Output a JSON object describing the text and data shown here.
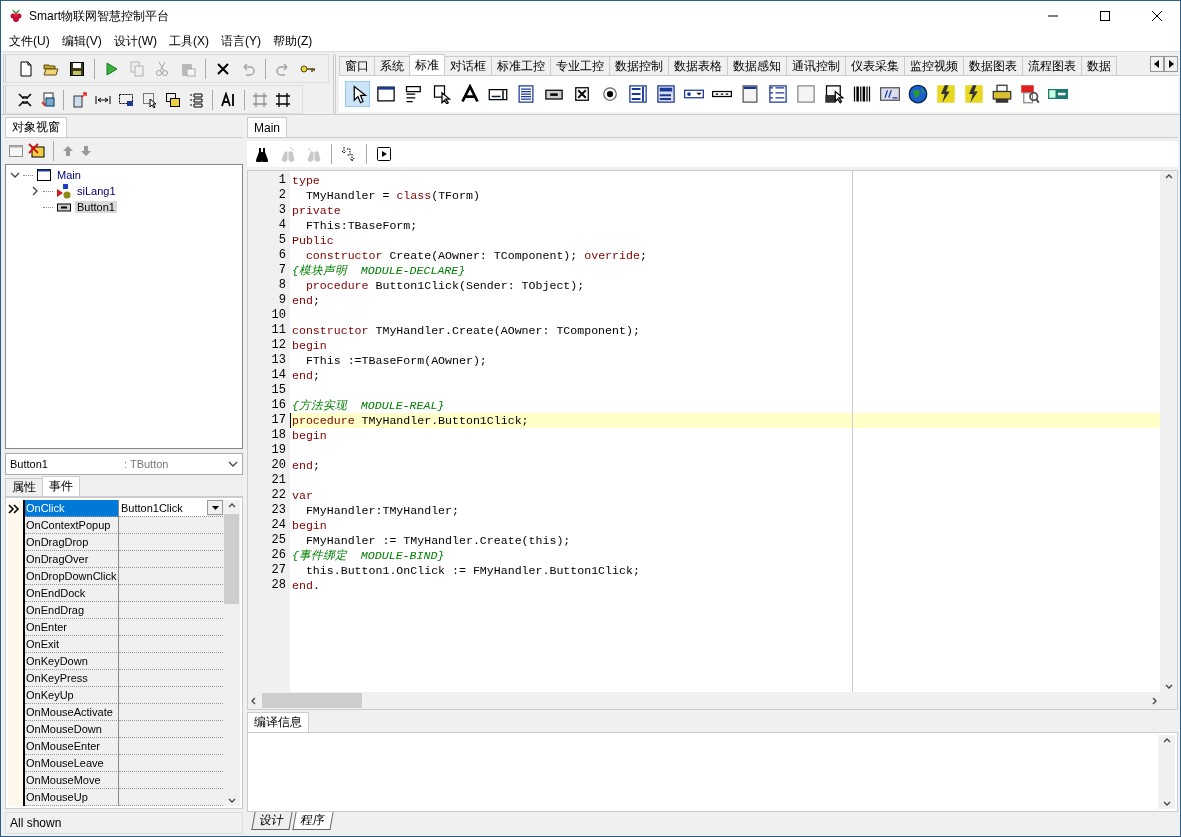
{
  "window": {
    "title": "Smart物联网智慧控制平台"
  },
  "menu": [
    "文件(U)",
    "编辑(V)",
    "设计(W)",
    "工具(X)",
    "语言(Y)",
    "帮助(Z)"
  ],
  "toolbar_main": [
    {
      "disabled": false
    },
    {
      "disabled": false
    },
    {
      "disabled": false
    },
    {
      "disabled": false
    },
    {
      "disabled": true
    },
    {
      "disabled": true
    },
    {
      "disabled": true
    },
    {
      "disabled": false
    },
    {
      "disabled": true
    },
    {
      "disabled": true
    },
    {
      "disabled": false
    }
  ],
  "toolbar_layout": [
    {
      "disabled": false
    },
    {
      "disabled": false
    },
    {
      "disabled": false
    },
    {
      "disabled": false
    },
    {
      "disabled": false
    },
    {
      "disabled": false
    },
    {
      "disabled": false
    },
    {
      "disabled": false
    },
    {
      "disabled": false
    },
    {
      "disabled": true
    },
    {
      "disabled": false
    }
  ],
  "palette": {
    "tabs": [
      {
        "label": "窗口",
        "selected": false
      },
      {
        "label": "系统",
        "selected": false
      },
      {
        "label": "标准",
        "selected": true
      },
      {
        "label": "对话框",
        "selected": false
      },
      {
        "label": "标准工控",
        "selected": false
      },
      {
        "label": "专业工控",
        "selected": false
      },
      {
        "label": "数据控制",
        "selected": false
      },
      {
        "label": "数据表格",
        "selected": false
      },
      {
        "label": "数据感知",
        "selected": false
      },
      {
        "label": "通讯控制",
        "selected": false
      },
      {
        "label": "仪表采集",
        "selected": false
      },
      {
        "label": "监控视频",
        "selected": false
      },
      {
        "label": "数据图表",
        "selected": false
      },
      {
        "label": "流程图表",
        "selected": false
      },
      {
        "label": "数据",
        "selected": false
      }
    ],
    "tools": [
      {
        "selected": true
      },
      {
        "selected": false
      },
      {
        "selected": false
      },
      {
        "selected": false
      },
      {
        "selected": false
      },
      {
        "selected": false
      },
      {
        "selected": false
      },
      {
        "selected": false
      },
      {
        "selected": false
      },
      {
        "selected": false
      },
      {
        "selected": false
      },
      {
        "selected": false
      },
      {
        "selected": false
      },
      {
        "selected": false
      },
      {
        "selected": false
      },
      {
        "selected": false
      },
      {
        "selected": false
      },
      {
        "selected": false
      },
      {
        "selected": false
      },
      {
        "selected": false
      },
      {
        "selected": false
      },
      {
        "selected": false
      },
      {
        "selected": false
      },
      {
        "selected": false
      },
      {
        "selected": false
      },
      {
        "selected": false
      }
    ]
  },
  "object_view": {
    "tab": "对象视窗",
    "tree": [
      {
        "label": "Main",
        "expanded": true,
        "selected": false,
        "children": [
          {
            "label": "siLang1",
            "expanded": false,
            "selected": false
          },
          {
            "label": "Button1",
            "selected": true
          }
        ]
      }
    ]
  },
  "inspector": {
    "object": "Button1",
    "class": ": TButton",
    "tabs": [
      {
        "label": "属性",
        "selected": false
      },
      {
        "label": "事件",
        "selected": true
      }
    ],
    "events": [
      {
        "name": "OnClick",
        "value": "Button1Click",
        "selected": true
      },
      {
        "name": "OnContextPopup",
        "selected": false
      },
      {
        "name": "OnDragDrop",
        "selected": false
      },
      {
        "name": "OnDragOver",
        "selected": false
      },
      {
        "name": "OnDropDownClick",
        "selected": false
      },
      {
        "name": "OnEndDock",
        "selected": false
      },
      {
        "name": "OnEndDrag",
        "selected": false
      },
      {
        "name": "OnEnter",
        "selected": false
      },
      {
        "name": "OnExit",
        "selected": false
      },
      {
        "name": "OnKeyDown",
        "selected": false
      },
      {
        "name": "OnKeyPress",
        "selected": false
      },
      {
        "name": "OnKeyUp",
        "selected": false
      },
      {
        "name": "OnMouseActivate",
        "selected": false
      },
      {
        "name": "OnMouseDown",
        "selected": false
      },
      {
        "name": "OnMouseEnter",
        "selected": false
      },
      {
        "name": "OnMouseLeave",
        "selected": false
      },
      {
        "name": "OnMouseMove",
        "selected": false
      },
      {
        "name": "OnMouseUp",
        "selected": false
      }
    ],
    "status": "All shown"
  },
  "editor": {
    "tab": "Main",
    "toolbar": [
      {
        "disabled": false
      },
      {
        "disabled": true
      },
      {
        "disabled": true
      },
      {
        "disabled": false
      },
      {
        "disabled": false
      }
    ],
    "lines": [
      {
        "num": "1",
        "current": false,
        "tokens": [
          {
            "kind": "keyword",
            "text": "type"
          }
        ]
      },
      {
        "num": "2",
        "current": false,
        "tokens": [
          {
            "kind": "text",
            "text": "  TMyHandler = "
          },
          {
            "kind": "keyword",
            "text": "class"
          },
          {
            "kind": "text",
            "text": "(TForm)"
          }
        ]
      },
      {
        "num": "3",
        "current": false,
        "tokens": [
          {
            "kind": "keyword",
            "text": "private"
          }
        ]
      },
      {
        "num": "4",
        "current": false,
        "tokens": [
          {
            "kind": "text",
            "text": "  FThis:TBaseForm;"
          }
        ]
      },
      {
        "num": "5",
        "current": false,
        "tokens": [
          {
            "kind": "keyword",
            "text": "Public"
          }
        ]
      },
      {
        "num": "6",
        "current": false,
        "tokens": [
          {
            "kind": "keyword",
            "text": "  constructor"
          },
          {
            "kind": "text",
            "text": " Create(AOwner: TComponent); "
          },
          {
            "kind": "keyword",
            "text": "override"
          },
          {
            "kind": "text",
            "text": ";"
          }
        ]
      },
      {
        "num": "7",
        "current": false,
        "tokens": [
          {
            "kind": "comment",
            "text": "{模块声明  MODULE-DECLARE}"
          }
        ]
      },
      {
        "num": "8",
        "current": false,
        "tokens": [
          {
            "kind": "keyword",
            "text": "  procedure"
          },
          {
            "kind": "text",
            "text": " Button1Click(Sender: TObject);"
          }
        ]
      },
      {
        "num": "9",
        "current": false,
        "tokens": [
          {
            "kind": "keyword",
            "text": "end"
          },
          {
            "kind": "text",
            "text": ";"
          }
        ]
      },
      {
        "num": "10",
        "current": false
      },
      {
        "num": "11",
        "current": false,
        "tokens": [
          {
            "kind": "keyword",
            "text": "constructor"
          },
          {
            "kind": "text",
            "text": " TMyHandler.Create(AOwner: TComponent);"
          }
        ]
      },
      {
        "num": "12",
        "current": false,
        "tokens": [
          {
            "kind": "keyword",
            "text": "begin"
          }
        ]
      },
      {
        "num": "13",
        "current": false,
        "tokens": [
          {
            "kind": "text",
            "text": "  FThis :=TBaseForm(AOwner);"
          }
        ]
      },
      {
        "num": "14",
        "current": false,
        "tokens": [
          {
            "kind": "keyword",
            "text": "end"
          },
          {
            "kind": "text",
            "text": ";"
          }
        ]
      },
      {
        "num": "15",
        "current": false
      },
      {
        "num": "16",
        "current": false,
        "tokens": [
          {
            "kind": "comment",
            "text": "{方法实现  MODULE-REAL}"
          }
        ]
      },
      {
        "num": "17",
        "current": true,
        "tokens": [
          {
            "kind": "keyword",
            "text": "procedure"
          },
          {
            "kind": "text",
            "text": " TMyHandler.Button1Click;"
          }
        ]
      },
      {
        "num": "18",
        "current": false,
        "tokens": [
          {
            "kind": "keyword",
            "text": "begin"
          }
        ]
      },
      {
        "num": "19",
        "current": false
      },
      {
        "num": "20",
        "current": false,
        "tokens": [
          {
            "kind": "keyword",
            "text": "end"
          },
          {
            "kind": "text",
            "text": ";"
          }
        ]
      },
      {
        "num": "21",
        "current": false
      },
      {
        "num": "22",
        "current": false,
        "tokens": [
          {
            "kind": "keyword",
            "text": "var"
          }
        ]
      },
      {
        "num": "23",
        "current": false,
        "tokens": [
          {
            "kind": "text",
            "text": "  FMyHandler:TMyHandler;"
          }
        ]
      },
      {
        "num": "24",
        "current": false,
        "tokens": [
          {
            "kind": "keyword",
            "text": "begin"
          }
        ]
      },
      {
        "num": "25",
        "current": false,
        "tokens": [
          {
            "kind": "text",
            "text": "  FMyHandler := TMyHandler.Create(this);"
          }
        ]
      },
      {
        "num": "26",
        "current": false,
        "tokens": [
          {
            "kind": "comment",
            "text": "{事件绑定  MODULE-BIND}"
          }
        ]
      },
      {
        "num": "27",
        "current": false,
        "tokens": [
          {
            "kind": "text",
            "text": "  this.Button1.OnClick := FMyHandler.Button1Click;"
          }
        ]
      },
      {
        "num": "28",
        "current": false,
        "tokens": [
          {
            "kind": "keyword",
            "text": "end"
          },
          {
            "kind": "text",
            "text": "."
          }
        ]
      }
    ]
  },
  "messages": {
    "tab": "编译信息"
  },
  "bottom_tabs": [
    {
      "label": "设计",
      "selected": false
    },
    {
      "label": "程序",
      "selected": true
    }
  ]
}
